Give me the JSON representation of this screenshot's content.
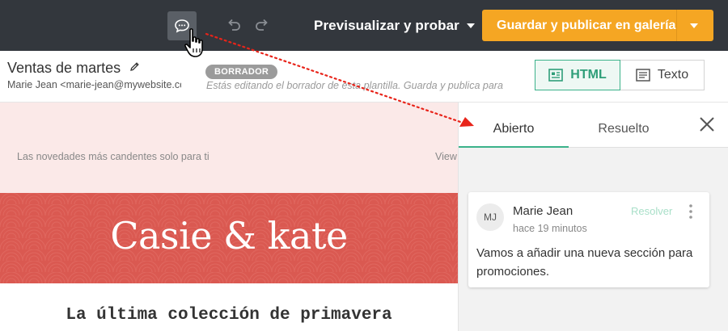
{
  "toolbar": {
    "comment_icon": "speech-bubble-icon",
    "undo_icon": "undo-icon",
    "redo_icon": "redo-icon",
    "preview_label": "Previsualizar y probar",
    "publish_label": "Guardar y publicar en galería",
    "colors": {
      "bar": "#33373d",
      "publish": "#f5a623"
    }
  },
  "template": {
    "title": "Ventas de martes",
    "sender": "Marie Jean <marie-jean@mywebsite.com>",
    "badge": "BORRADOR",
    "draft_note": "Estás editando el borrador de esta plantilla. Guarda y publica para"
  },
  "view_tabs": [
    {
      "label": "HTML",
      "active": true,
      "icon": "html-doc-icon"
    },
    {
      "label": "Texto",
      "active": false,
      "icon": "text-doc-icon"
    }
  ],
  "email": {
    "preheader_text": "Las novedades más candentes solo para ti",
    "view_link": "View",
    "brand": "Casie & kate",
    "headline": "La última colección de primavera",
    "colors": {
      "preheader_bg": "#fbe9e8",
      "banner_bg": "#da5951"
    }
  },
  "comments_panel": {
    "tabs": [
      {
        "label": "Abierto",
        "active": true
      },
      {
        "label": "Resuelto",
        "active": false
      }
    ],
    "comment": {
      "initials": "MJ",
      "author": "Marie Jean",
      "time": "hace 19 minutos",
      "resolve_label": "Resolver",
      "text": "Vamos a añadir una nueva sección para promociones."
    },
    "accent": "#3bb28a"
  }
}
